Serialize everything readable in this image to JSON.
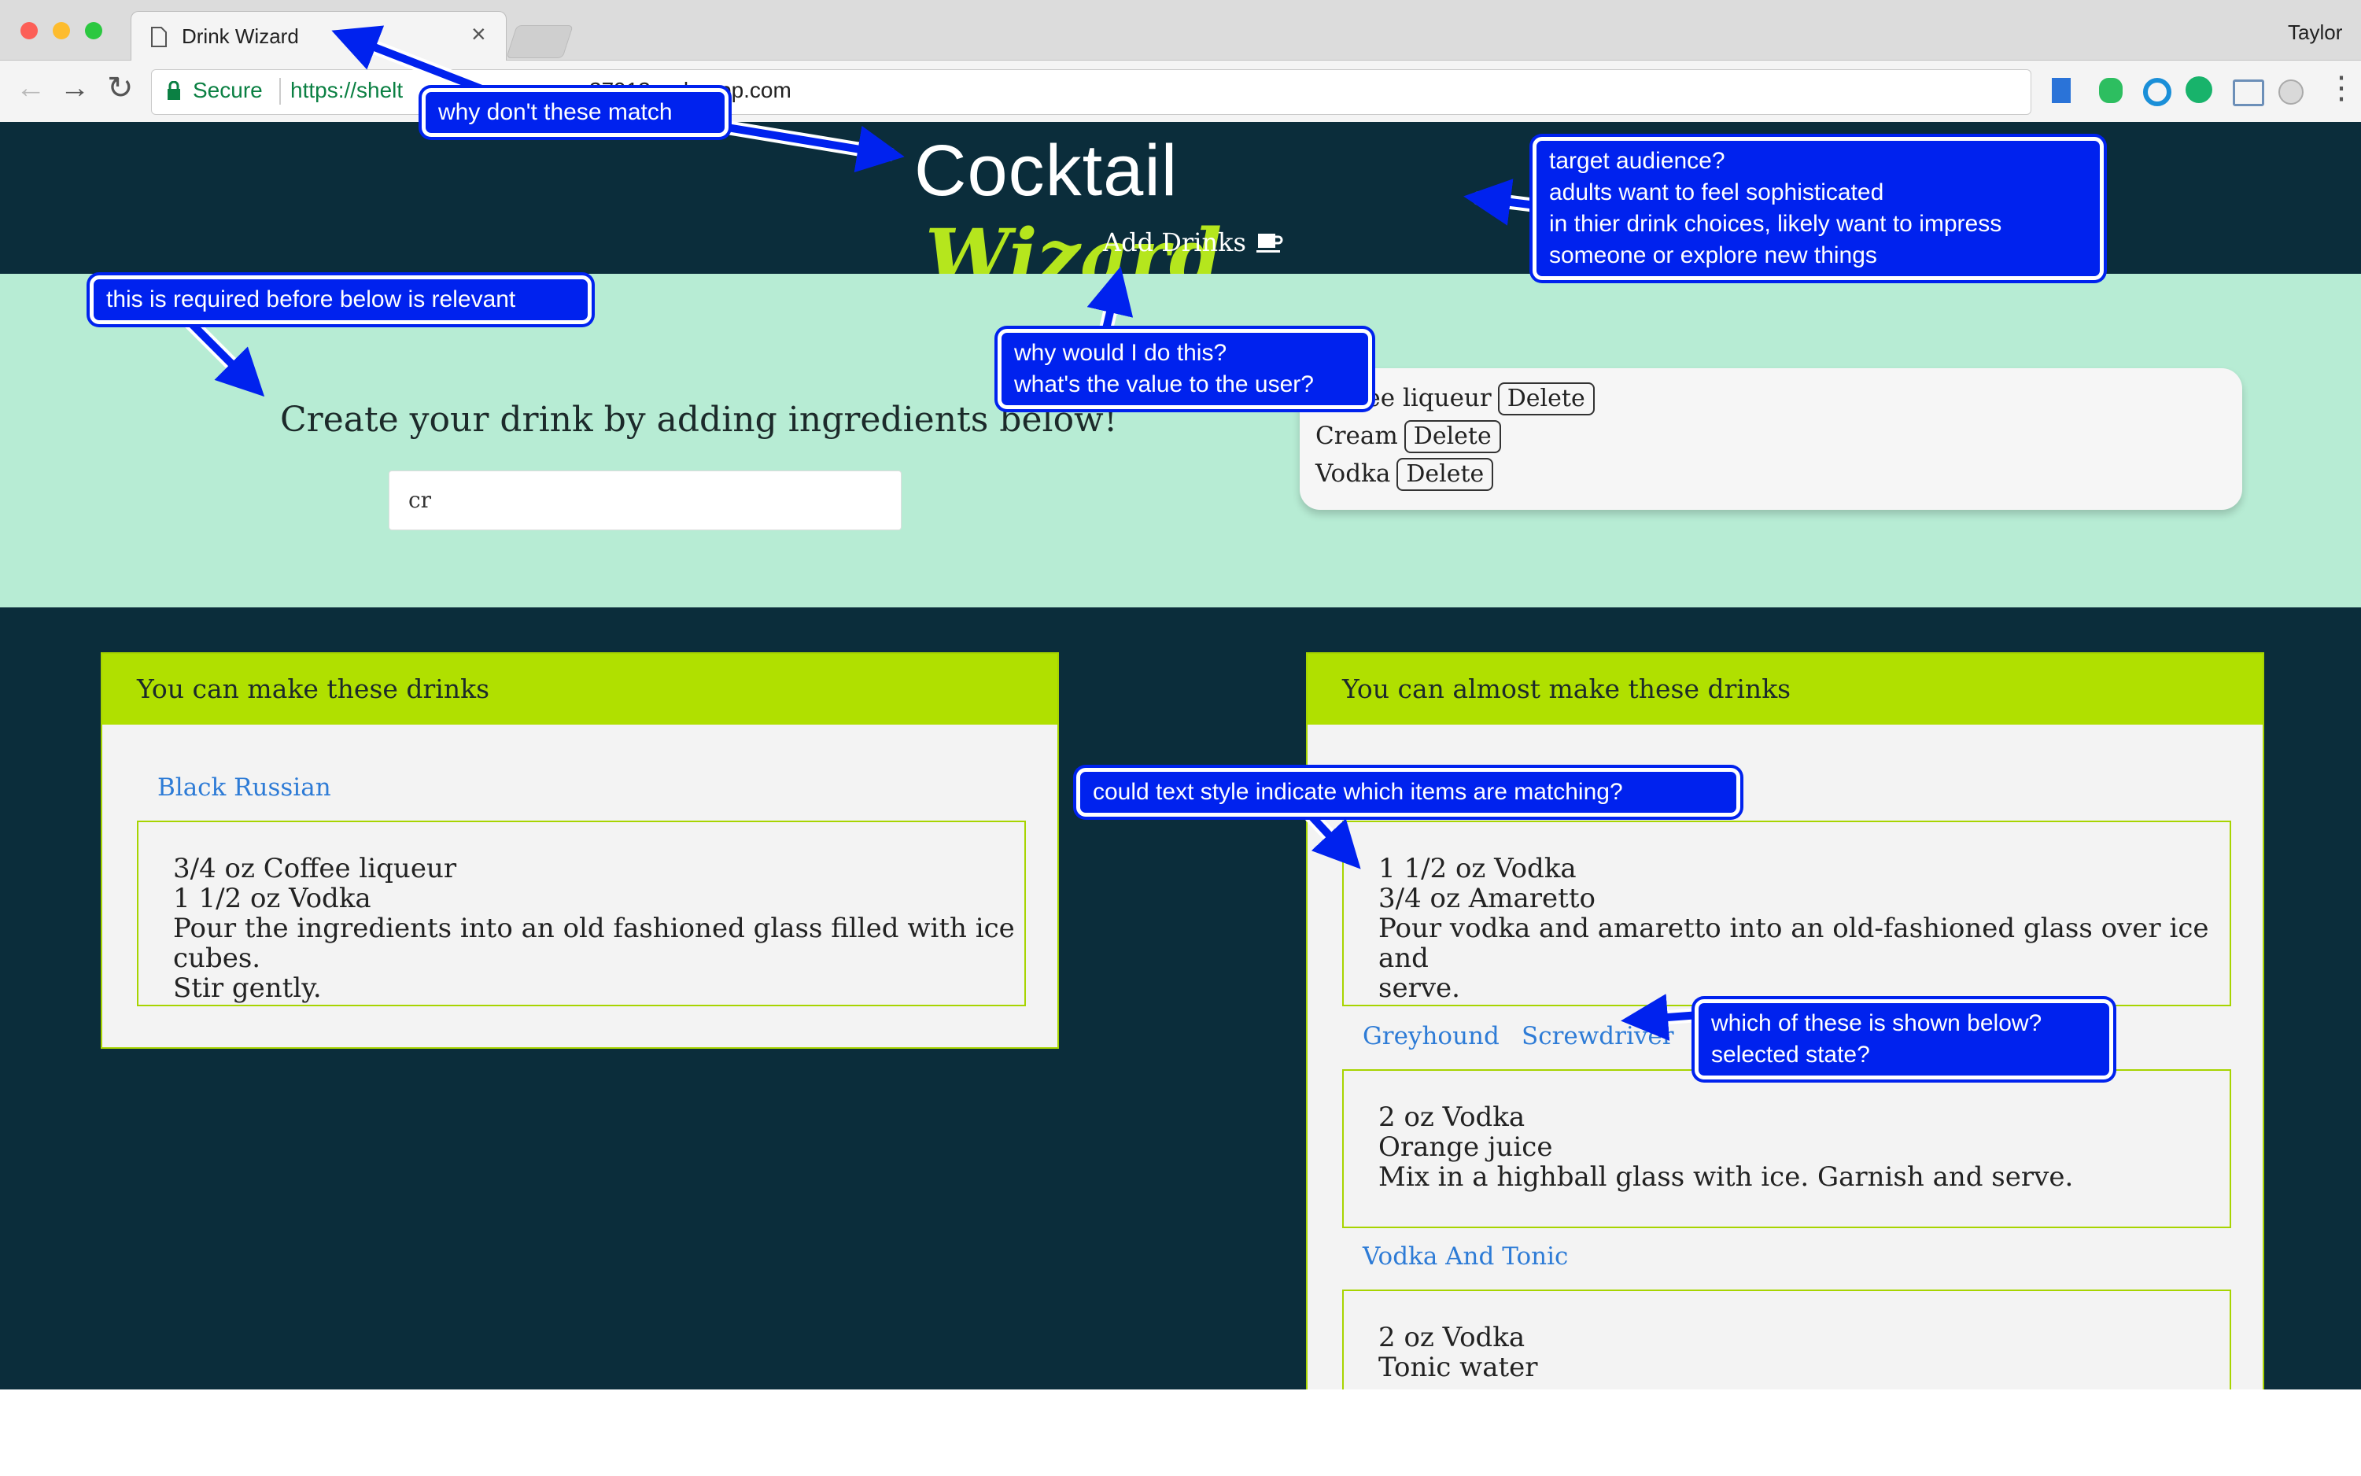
{
  "browser": {
    "tab_title": "Drink Wizard",
    "tab_close": "×",
    "user": "Taylor",
    "secure_label": "Secure",
    "url_scheme": "https://shelt",
    "url_partial": "37913-.rokuapp.com"
  },
  "header": {
    "title_part1": "Cocktail",
    "title_part2": "Wizard",
    "nav_add_drinks": "Add Drinks"
  },
  "hero": {
    "prompt": "Create your drink by adding ingredients below!",
    "search_value": "cr",
    "ingredients": [
      {
        "name": "Coffee liqueur",
        "delete_label": "Delete"
      },
      {
        "name": "Cream",
        "delete_label": "Delete"
      },
      {
        "name": "Vodka",
        "delete_label": "Delete"
      }
    ]
  },
  "can_make": {
    "title": "You can make these drinks",
    "drinks": [
      {
        "name": "Black Russian",
        "lines": [
          "3/4 oz Coffee liqueur",
          "1 1/2 oz Vodka",
          "Pour the ingredients into an old fashioned glass filled with ice cubes.",
          "Stir gently."
        ]
      }
    ]
  },
  "almost_make": {
    "title": "You can almost make these drinks",
    "recipe1_lines": [
      "1 1/2 oz Vodka",
      "3/4 oz Amaretto",
      "Pour vodka and amaretto into an old-fashioned glass over ice and",
      "serve."
    ],
    "links": [
      "Greyhound",
      "Screwdriver"
    ],
    "recipe2_lines": [
      "2 oz Vodka",
      "Orange juice",
      "Mix in a highball glass with ice. Garnish and serve."
    ],
    "link3": "Vodka And Tonic",
    "recipe3_lines": [
      "2 oz Vodka",
      "Tonic water"
    ]
  },
  "annotations": {
    "a1": "why don't these match",
    "a2": "target audience?\nadults want to feel sophisticated\nin thier drink choices, likely want to impress\nsomeone or explore new things",
    "a3": "this is required before below is relevant",
    "a4": "why would I do this?\nwhat's the value to the user?",
    "a5": "could text style indicate which items are matching?",
    "a6": "which of these is shown below?\nselected state?"
  },
  "colors": {
    "header_bg": "#0b2d3b",
    "hero_bg": "#b7ecd4",
    "card_accent": "#b0e000",
    "link": "#2d7bd6",
    "annotation": "#0022ee",
    "title_wizard": "#b5e61d"
  }
}
